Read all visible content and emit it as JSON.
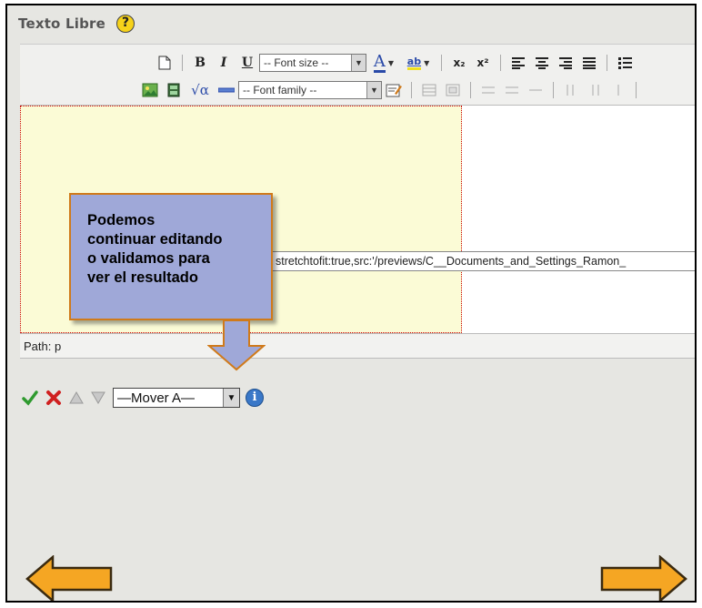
{
  "title": "Texto Libre",
  "help_icon": "?",
  "toolbar": {
    "new_doc_icon": "new-document-icon",
    "bold": "B",
    "italic": "I",
    "underline": "U",
    "font_size": "-- Font size --",
    "font_color": "A",
    "highlight": "ab",
    "subscript": "x₂",
    "superscript": "x²",
    "font_family": "-- Font family --",
    "math": "√α"
  },
  "editor": {
    "src_text": "stretchtofit:true,src:'/previews/C__Documents_and_Settings_Ramon_"
  },
  "path": "Path: p",
  "callout": {
    "lines": [
      "Podemos",
      "continuar editando",
      "o validamos para",
      "ver el resultado"
    ],
    "fill": "#9fa8d8",
    "border": "#d07a1a"
  },
  "controls": {
    "mover_label": "—Mover A—"
  },
  "nav": {
    "arrow_color": "#f5a623"
  }
}
